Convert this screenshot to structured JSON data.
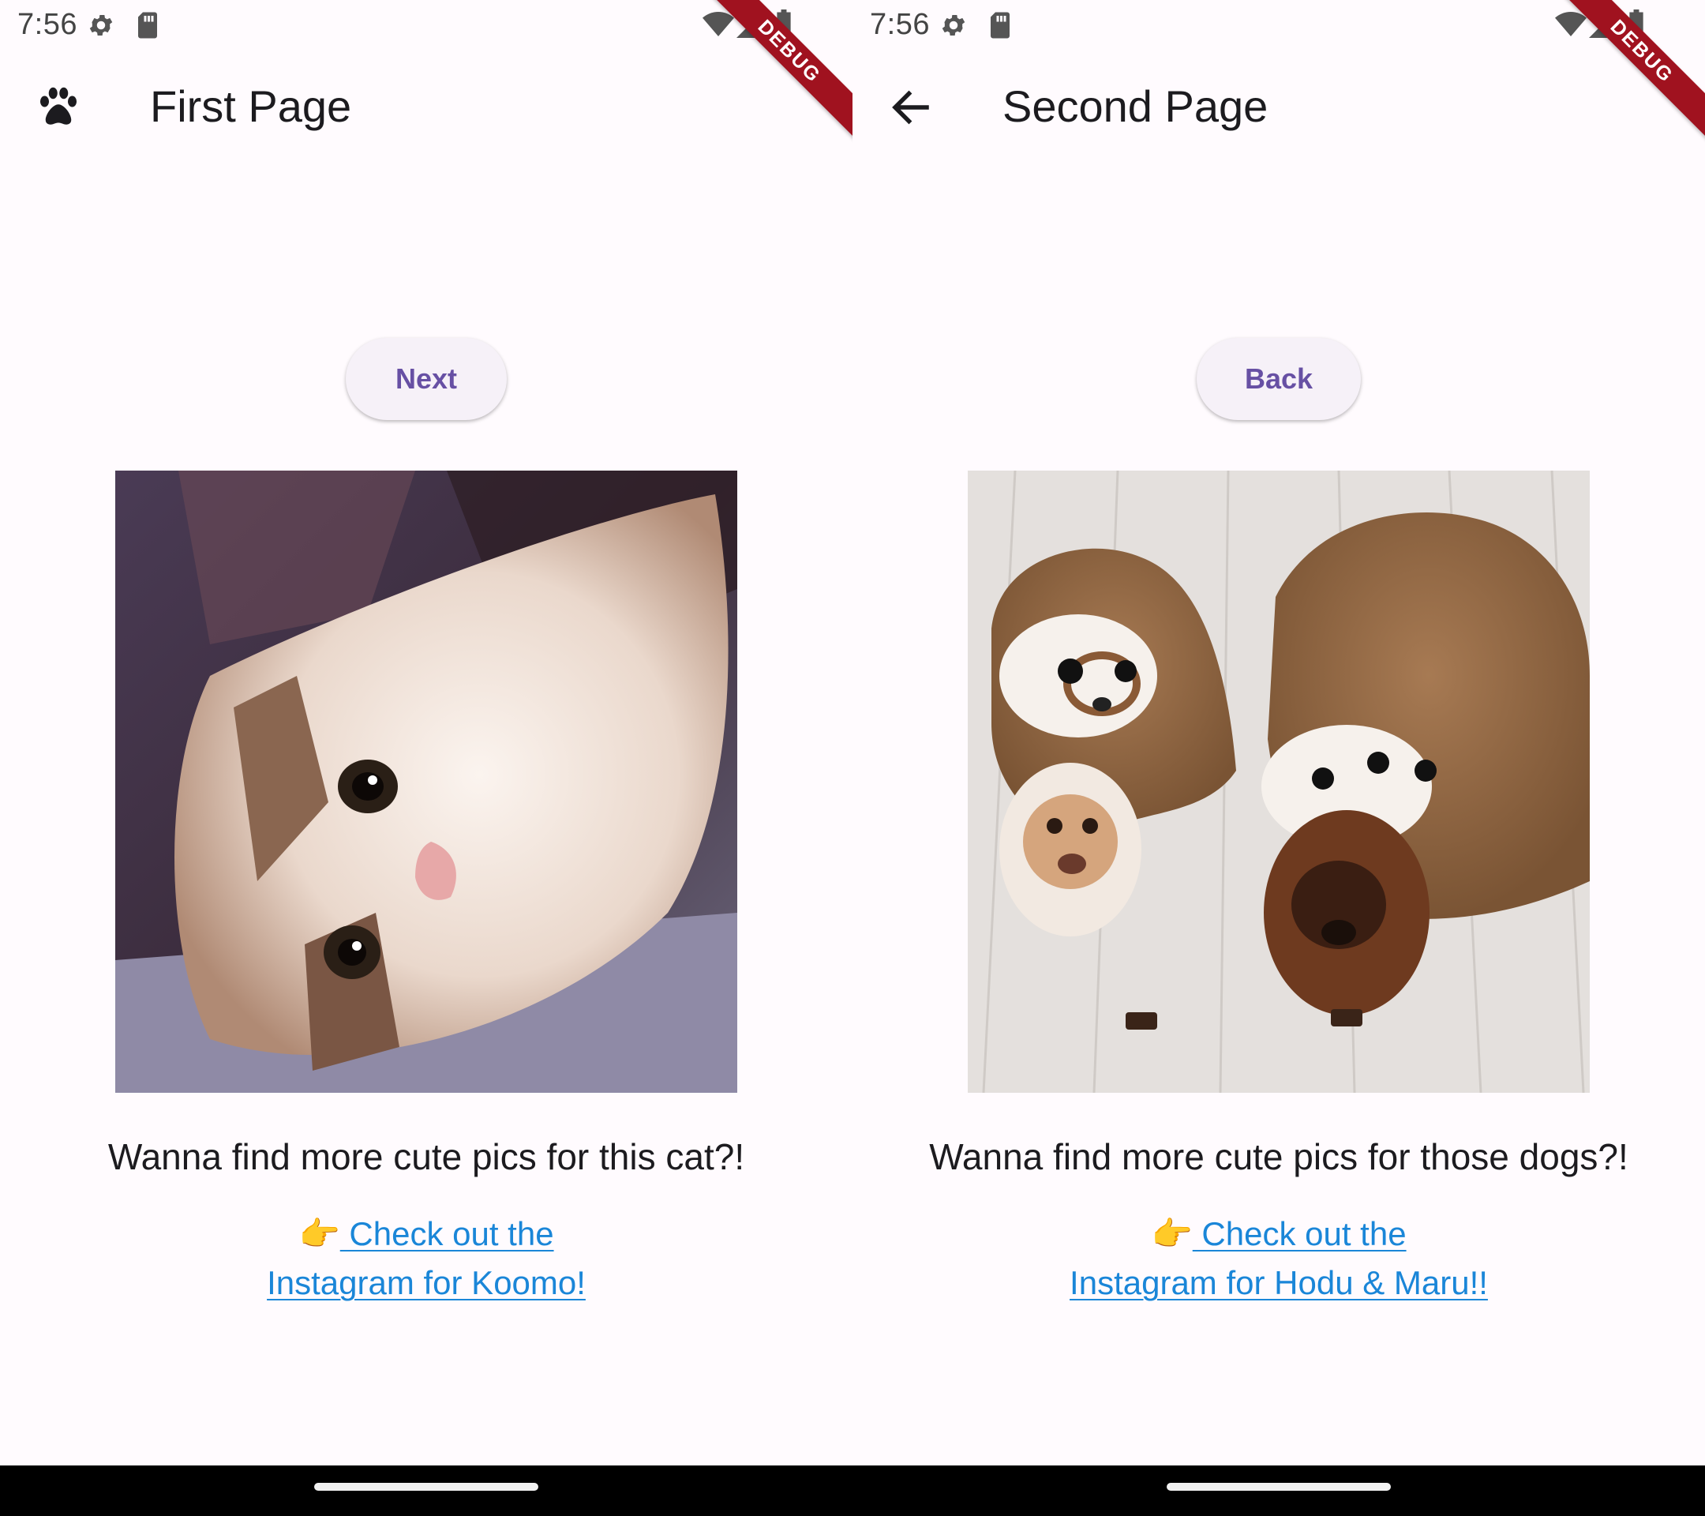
{
  "left": {
    "status": {
      "time": "7:56"
    },
    "debug_banner": "DEBUG",
    "app_bar": {
      "title": "First Page",
      "leading_icon": "paw-icon"
    },
    "button_label": "Next",
    "photo_subject": "cat",
    "caption": "Wanna find more cute pics for this cat?!",
    "link": {
      "emoji": "👉",
      "line1": " Check out the",
      "line2": "Instagram for Koomo!"
    }
  },
  "right": {
    "status": {
      "time": "7:56"
    },
    "debug_banner": "DEBUG",
    "app_bar": {
      "title": "Second Page",
      "leading_icon": "back-arrow-icon"
    },
    "button_label": "Back",
    "photo_subject": "dogs",
    "caption": "Wanna find more cute pics for those dogs?!",
    "link": {
      "emoji": "👉",
      "line1": " Check out the",
      "line2": "Instagram for Hodu & Maru!!"
    }
  },
  "colors": {
    "background": "#fffbfe",
    "button_text": "#6750a4",
    "button_bg": "#f6f1f8",
    "link": "#1a86d8",
    "debug_ribbon": "#a0121f"
  }
}
